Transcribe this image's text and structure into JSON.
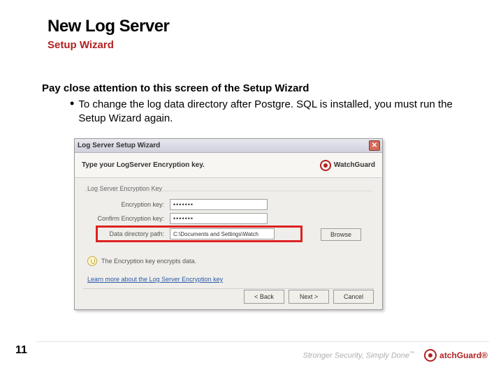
{
  "page": {
    "title": "New Log Server",
    "subtitle": "Setup Wizard",
    "instruction": "Pay close attention to this screen of the Setup Wizard",
    "bullet": "To change the log data directory after Postgre. SQL is installed, you must run the Setup Wizard again.",
    "number": "11"
  },
  "wizard": {
    "titlebar": "Log Server Setup Wizard",
    "close_icon": "✕",
    "banner_text": "Type your LogServer Encryption key.",
    "brand": "WatchGuard",
    "fieldset_label": "Log Server Encryption Key",
    "encryption_key_label": "Encryption key:",
    "encryption_key_value": "•••••••",
    "confirm_key_label": "Confirm Encryption key:",
    "confirm_key_value": "•••••••",
    "data_dir_label": "Data directory path:",
    "data_dir_value": "C:\\Documents and Settings\\Watch",
    "browse_label": "Browse",
    "hint_text": "The Encryption key encrypts data.",
    "link_text": "Learn more about the Log Server Encryption key",
    "back_label": "< Back",
    "next_label": "Next >",
    "cancel_label": "Cancel"
  },
  "footer": {
    "tagline": "Stronger Security, Simply Done",
    "tm": "™",
    "brand": "atchGuard",
    "reg": "®"
  }
}
